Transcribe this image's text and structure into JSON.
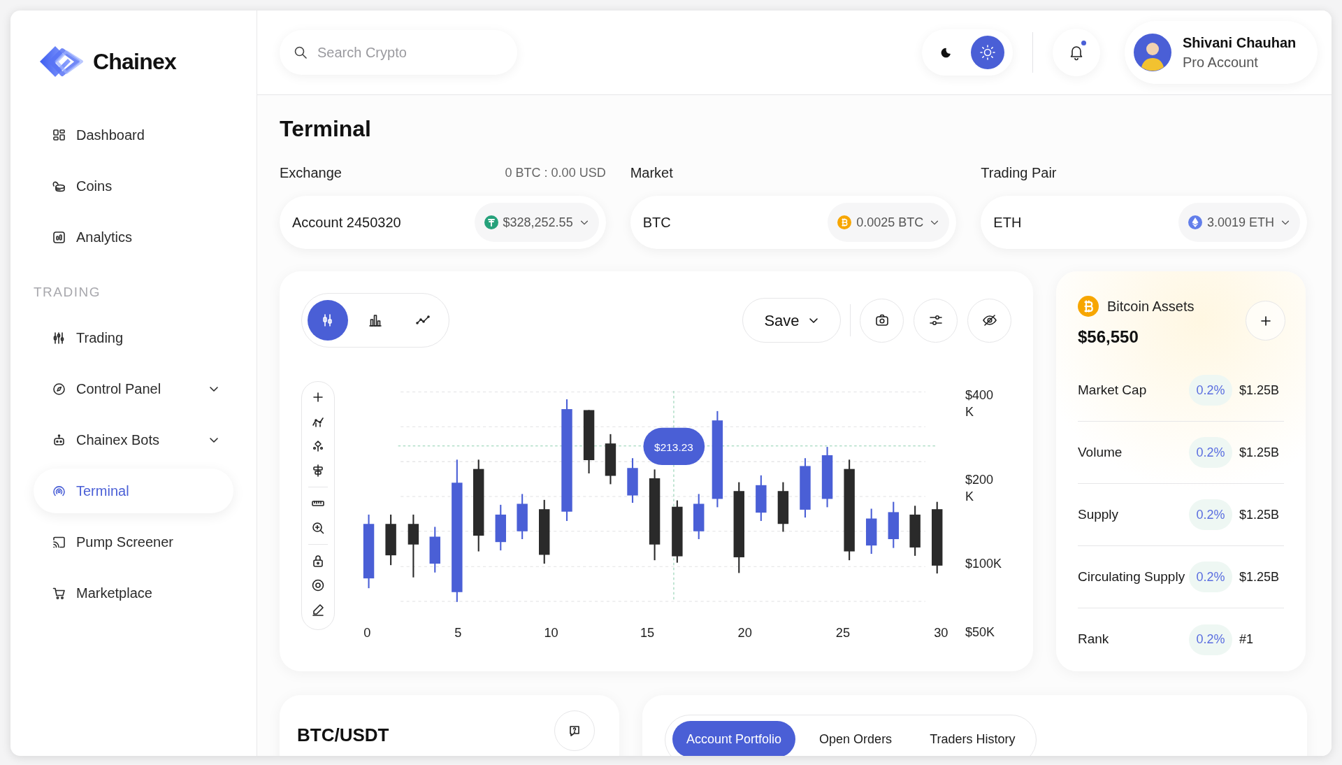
{
  "brand": {
    "name": "Chainex"
  },
  "sidebar": {
    "groups": [
      {
        "items": [
          {
            "label": "Dashboard",
            "selected": false,
            "expandable": false
          },
          {
            "label": "Coins",
            "selected": false,
            "expandable": false
          },
          {
            "label": "Analytics",
            "selected": false,
            "expandable": false
          }
        ]
      },
      {
        "title": "TRADING",
        "items": [
          {
            "label": "Trading",
            "selected": false,
            "expandable": false
          },
          {
            "label": "Control Panel",
            "selected": false,
            "expandable": true
          },
          {
            "label": "Chainex Bots",
            "selected": false,
            "expandable": true
          },
          {
            "label": "Terminal",
            "selected": true,
            "expandable": false
          },
          {
            "label": "Pump Screener",
            "selected": false,
            "expandable": false
          },
          {
            "label": "Marketplace",
            "selected": false,
            "expandable": false
          }
        ]
      }
    ]
  },
  "topbar": {
    "search": {
      "placeholder": "Search Crypto"
    },
    "light_mode": true,
    "notifications": {
      "unread": true
    },
    "user": {
      "name": "Shivani Chauhan",
      "role": "Pro Account"
    }
  },
  "page": {
    "title": "Terminal"
  },
  "selectors": [
    {
      "label": "Exchange",
      "note": "0 BTC : 0.00 USD",
      "value": "Account 2450320",
      "amount": "$328,252.55",
      "color": "#26a17b"
    },
    {
      "label": "Market",
      "value": "BTC",
      "amount": "0.0025 BTC",
      "color": "#f7a600"
    },
    {
      "label": "Trading Pair",
      "value": "ETH",
      "amount": "3.0019 ETH",
      "color": "#627eea"
    }
  ],
  "chart": {
    "chart_types": [
      {
        "selected": true
      },
      {
        "selected": false
      },
      {
        "selected": false
      }
    ],
    "save_button": "Save",
    "tooltip": "$213.23",
    "x_labels": [
      "0",
      "5",
      "10",
      "15",
      "20",
      "25",
      "30"
    ],
    "y_labels": [
      "$400 K",
      "$200 K",
      "$100K",
      "$50K"
    ]
  },
  "assets": {
    "title": "Bitcoin Assets",
    "value": "$56,550",
    "rows": [
      {
        "label": "Market Cap",
        "change": "0.2%",
        "value": "$1.25B"
      },
      {
        "label": "Volume",
        "change": "0.2%",
        "value": "$1.25B"
      },
      {
        "label": "Supply",
        "change": "0.2%",
        "value": "$1.25B"
      },
      {
        "label": "Circulating Supply",
        "change": "0.2%",
        "value": "$1.25B"
      },
      {
        "label": "Rank",
        "change": "0.2%",
        "value": "#1"
      }
    ]
  },
  "pair_card": {
    "title": "BTC/USDT"
  },
  "tabs": [
    {
      "label": "Account Portfolio",
      "selected": true
    },
    {
      "label": "Open Orders",
      "selected": false
    },
    {
      "label": "Traders History",
      "selected": false
    }
  ]
}
